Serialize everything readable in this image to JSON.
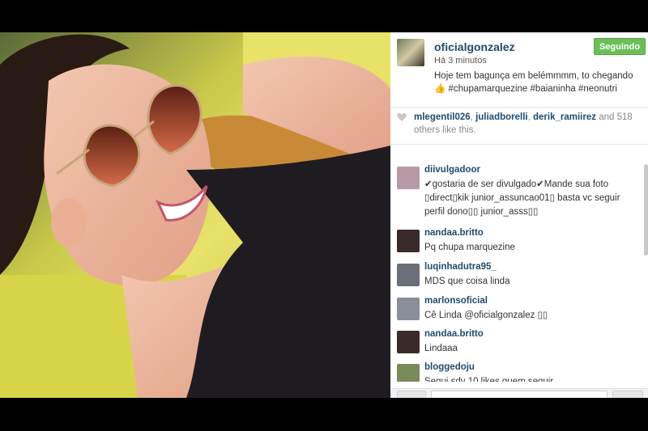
{
  "post": {
    "username": "oficialgonzalez",
    "time": "Há 3 minutos",
    "caption": "Hoje tem bagunça em belémmmm, to chegando 👍 #chupamarquezine #baianinha #neonutri",
    "follow_label": "Seguindo"
  },
  "likes": {
    "user1": "mlegentil026",
    "user2": "juliadborelli",
    "user3": "derik_ramiirez",
    "rest": " and 518 others like this."
  },
  "comments": [
    {
      "user": "diivulgadoor",
      "text": "✔gostaria de ser divulgado✔Mande sua foto ▯direct▯kik junior_assuncao01▯ basta vc seguir perfil dono▯▯ junior_asss▯▯",
      "avatar_color": "#b89aa6"
    },
    {
      "user": "nandaa.britto",
      "text": "Pq chupa marquezine",
      "avatar_color": "#3a2a2a"
    },
    {
      "user": "luqinhadutra95_",
      "text": "MDS que coisa linda",
      "avatar_color": "#6a6f7a"
    },
    {
      "user": "marlonsoficial",
      "text": "Cê Linda @oficialgonzalez ▯▯",
      "avatar_color": "#8a8f9a"
    },
    {
      "user": "nandaa.britto",
      "text": "Lindaaa",
      "avatar_color": "#3a2a2a"
    },
    {
      "user": "bloggedoju",
      "text": "Segui sdv 10 likes quem seguir",
      "avatar_color": "#7a8a5a"
    }
  ],
  "icons": {
    "heart": "heart-icon"
  },
  "colors": {
    "follow": "#6bbf59",
    "link": "#1f4b6e"
  }
}
